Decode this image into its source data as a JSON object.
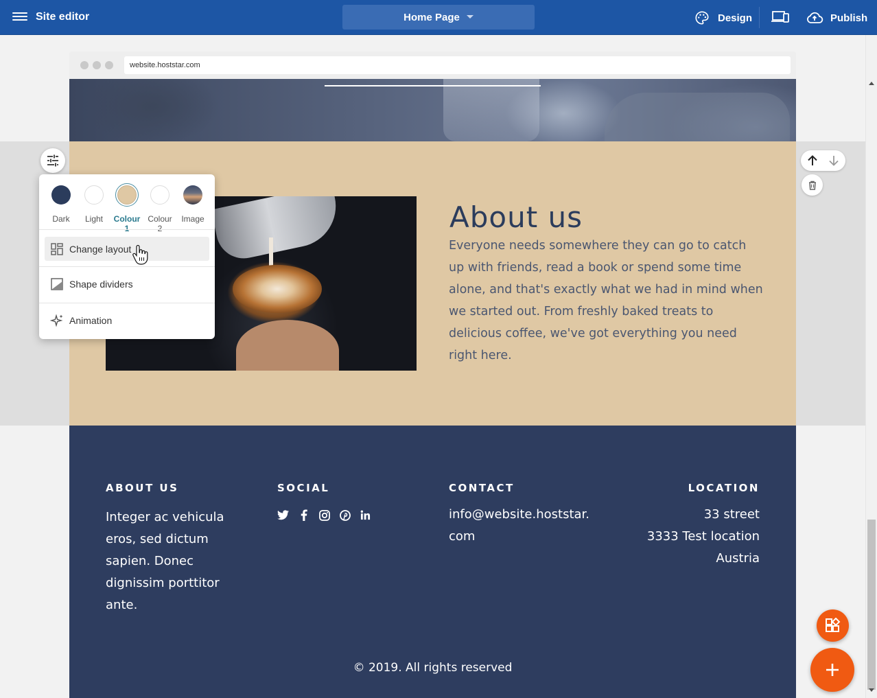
{
  "topbar": {
    "app_title": "Site editor",
    "page_selector": "Home Page",
    "design_label": "Design",
    "publish_label": "Publish"
  },
  "browser": {
    "url": "website.hoststar.com"
  },
  "colors": {
    "topbar": "#1d56a5",
    "about_bg": "#dfc8a4",
    "footer_bg": "#2e3d5f",
    "accent": "#f05a12",
    "active_swatch": "#2a7a8e"
  },
  "about": {
    "title": "About us",
    "text": "Everyone needs somewhere they can go to catch up with friends, read a book or spend some time alone, and that's exactly what we had in mind when we started out. From freshly baked treats to delicious coffee, we've got everything you need right here."
  },
  "section_menu": {
    "swatches": [
      {
        "label": "Dark",
        "color": "#2b3c5c"
      },
      {
        "label": "Light",
        "color": "#ffffff"
      },
      {
        "label": "Colour 1",
        "color": "#dfc8a4",
        "selected": true
      },
      {
        "label": "Colour 2",
        "color": "#ffffff"
      },
      {
        "label": "Image",
        "icon": "image-swatch"
      }
    ],
    "items": [
      {
        "label": "Change layout",
        "icon": "layout-icon"
      },
      {
        "label": "Shape dividers",
        "icon": "shape-divider-icon"
      },
      {
        "label": "Animation",
        "icon": "sparkle-icon"
      }
    ]
  },
  "footer": {
    "about_heading": "ABOUT US",
    "about_text": "Integer ac vehicula eros, sed dictum sapien. Donec dignissim porttitor ante.",
    "social_heading": "SOCIAL",
    "social_icons": [
      "twitter-icon",
      "facebook-icon",
      "instagram-icon",
      "pinterest-icon",
      "linkedin-icon"
    ],
    "contact_heading": "CONTACT",
    "contact_line1": "info@website.hoststar.",
    "contact_line2": "com",
    "location_heading": "LOCATION",
    "location_line1": "33 street",
    "location_line2": "3333 Test location",
    "location_line3": "Austria",
    "copyright": "© 2019. All rights reserved"
  }
}
